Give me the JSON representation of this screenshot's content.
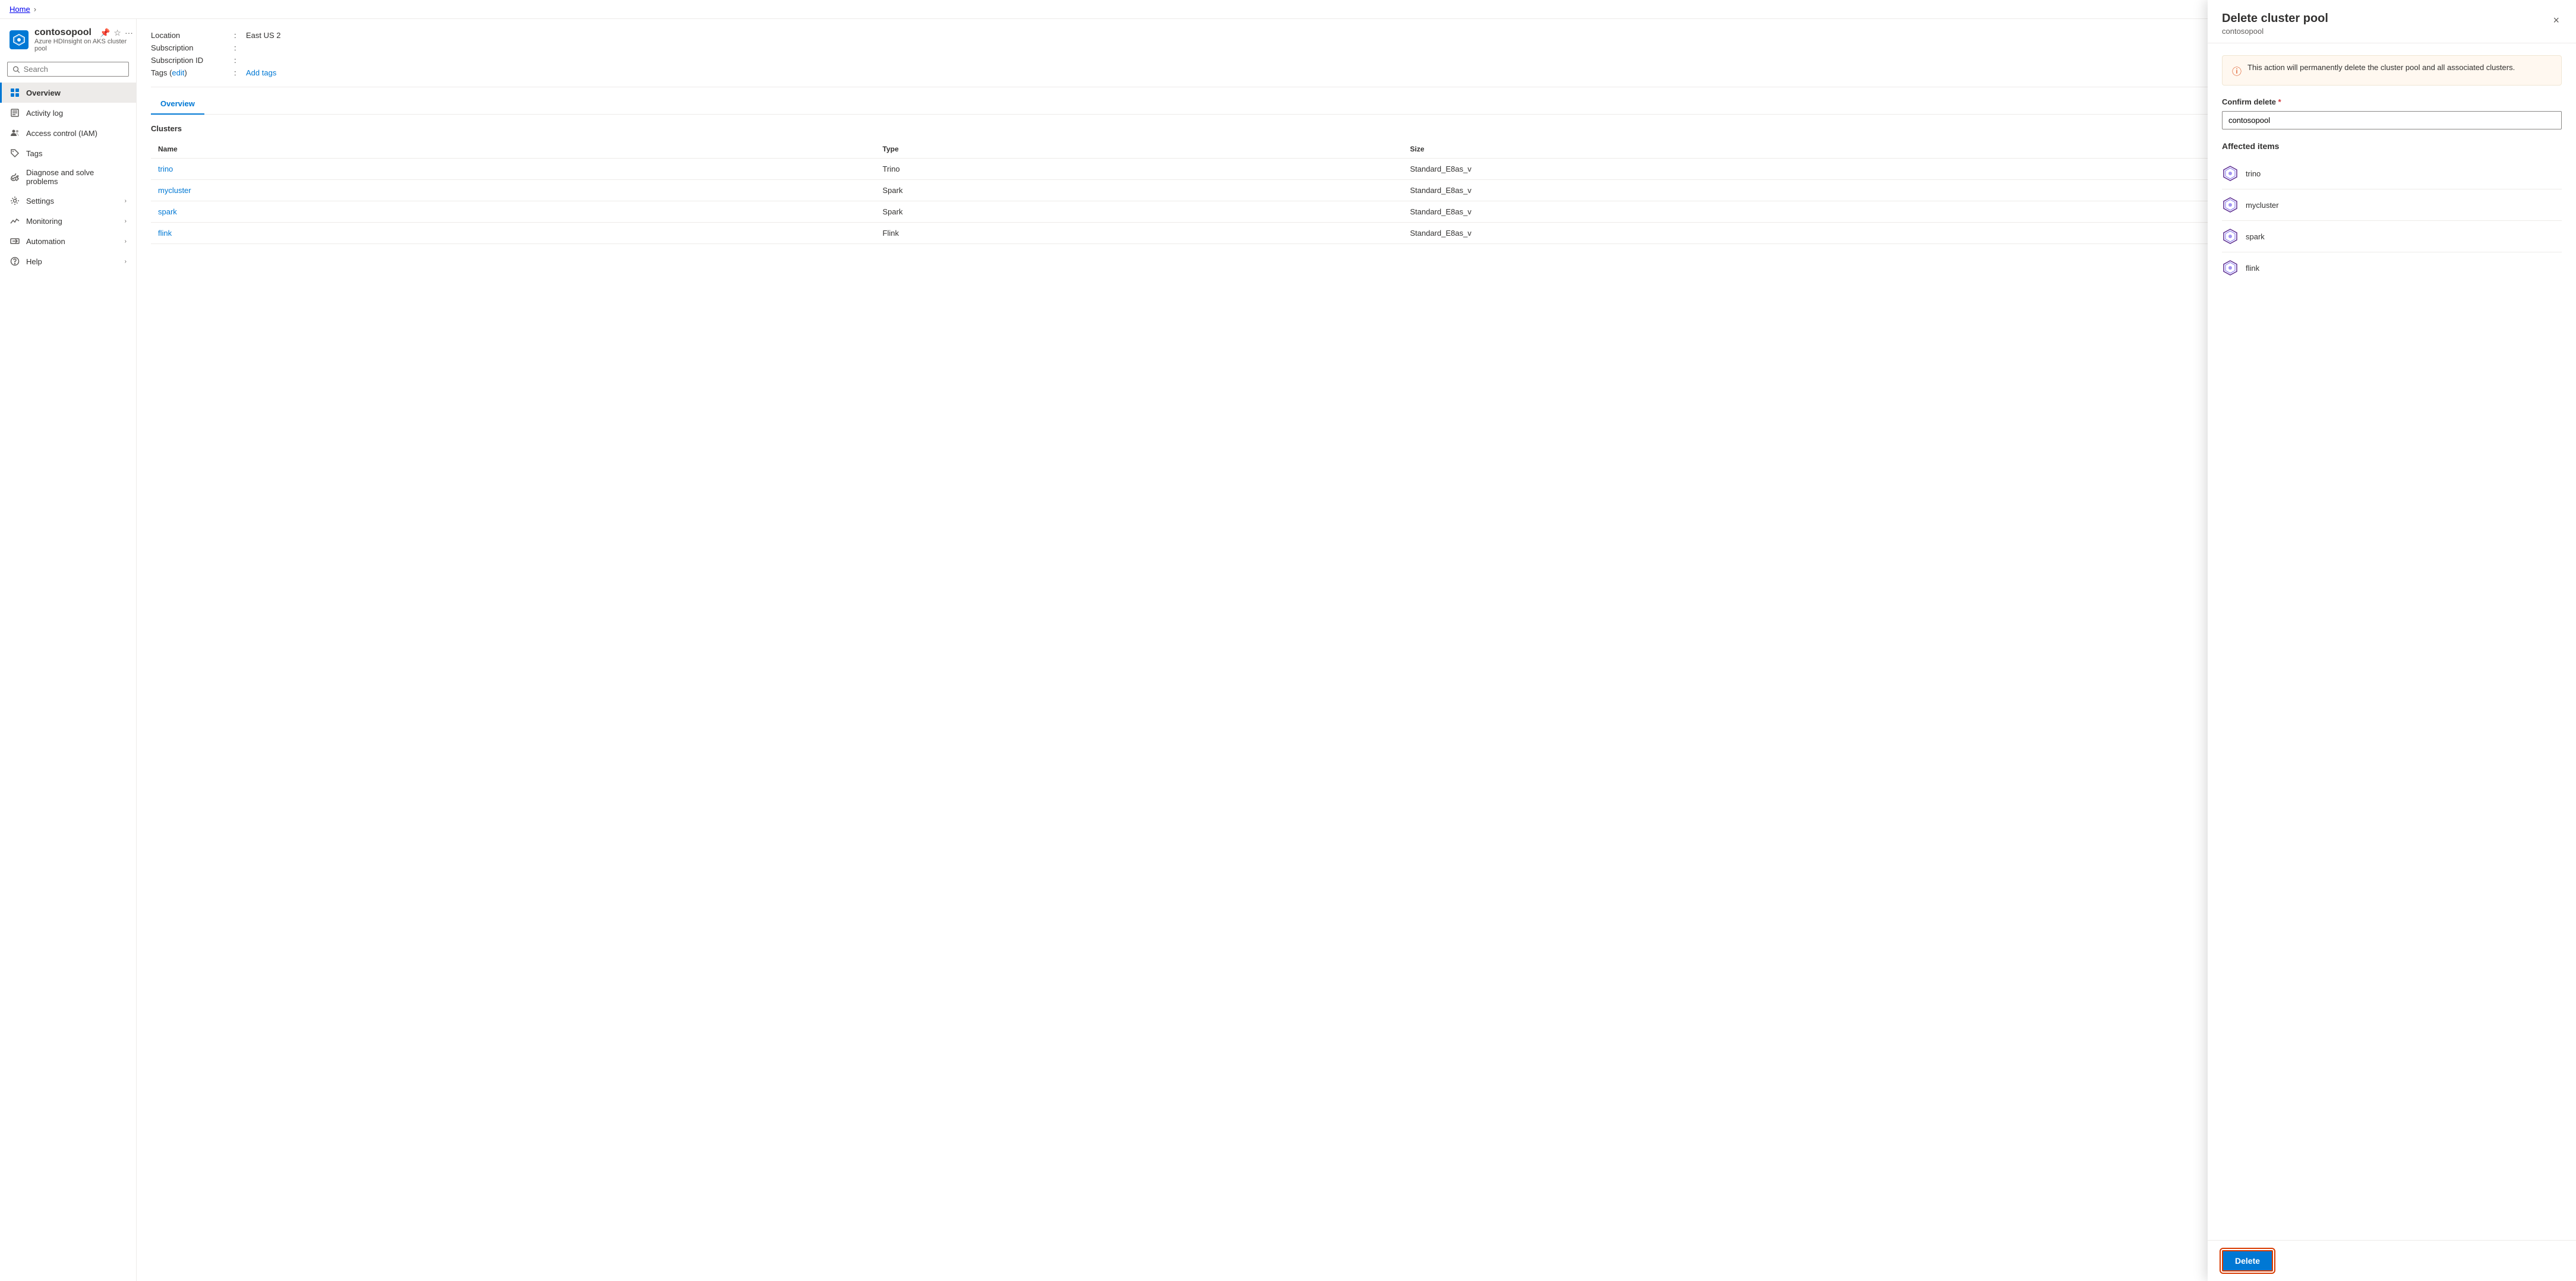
{
  "breadcrumb": {
    "home_label": "Home",
    "chevron": "›"
  },
  "sidebar": {
    "logo_alt": "HDInsight on AKS",
    "resource_name": "contosopool",
    "resource_subtitle": "Azure HDInsight on AKS cluster pool",
    "pin_icon": "pin",
    "star_icon": "star",
    "more_icon": "more",
    "collapse_icon": "«",
    "search_placeholder": "Search",
    "nav_items": [
      {
        "id": "overview",
        "label": "Overview",
        "icon": "grid",
        "active": true,
        "expandable": false
      },
      {
        "id": "activity-log",
        "label": "Activity log",
        "icon": "list",
        "active": false,
        "expandable": false
      },
      {
        "id": "access-control",
        "label": "Access control (IAM)",
        "icon": "people",
        "active": false,
        "expandable": false
      },
      {
        "id": "tags",
        "label": "Tags",
        "icon": "tag",
        "active": false,
        "expandable": false
      },
      {
        "id": "diagnose",
        "label": "Diagnose and solve problems",
        "icon": "wrench",
        "active": false,
        "expandable": false
      },
      {
        "id": "settings",
        "label": "Settings",
        "icon": "settings",
        "active": false,
        "expandable": true
      },
      {
        "id": "monitoring",
        "label": "Monitoring",
        "icon": "monitoring",
        "active": false,
        "expandable": true
      },
      {
        "id": "automation",
        "label": "Automation",
        "icon": "automation",
        "active": false,
        "expandable": true
      },
      {
        "id": "help",
        "label": "Help",
        "icon": "help",
        "active": false,
        "expandable": true
      }
    ]
  },
  "main": {
    "meta": {
      "location_label": "Location",
      "location_value": "East US 2",
      "subscription_label": "Subscription",
      "subscription_value": "",
      "subscription_id_label": "Subscription ID",
      "subscription_id_value": "",
      "tags_label": "Tags (edit)",
      "tags_edit": "edit",
      "tags_action": "Add tags"
    },
    "tabs": [
      {
        "id": "overview",
        "label": "Overview",
        "active": true
      }
    ],
    "clusters_heading": "Clusters",
    "table_headers": [
      "Name",
      "Type",
      "Size"
    ],
    "clusters": [
      {
        "name": "trino",
        "type": "Trino",
        "size": "Standard_E8as_v"
      },
      {
        "name": "mycluster",
        "type": "Spark",
        "size": "Standard_E8as_v"
      },
      {
        "name": "spark",
        "type": "Spark",
        "size": "Standard_E8as_v"
      },
      {
        "name": "flink",
        "type": "Flink",
        "size": "Standard_E8as_v"
      }
    ]
  },
  "panel": {
    "title": "Delete cluster pool",
    "subtitle": "contosopool",
    "close_label": "×",
    "warning_text": "This action will permanently delete the cluster pool and all associated clusters.",
    "confirm_label": "Confirm delete",
    "confirm_placeholder": "",
    "confirm_value": "contosopool",
    "affected_heading": "Affected items",
    "affected_items": [
      {
        "name": "trino"
      },
      {
        "name": "mycluster"
      },
      {
        "name": "spark"
      },
      {
        "name": "flink"
      }
    ],
    "delete_button_label": "Delete"
  }
}
